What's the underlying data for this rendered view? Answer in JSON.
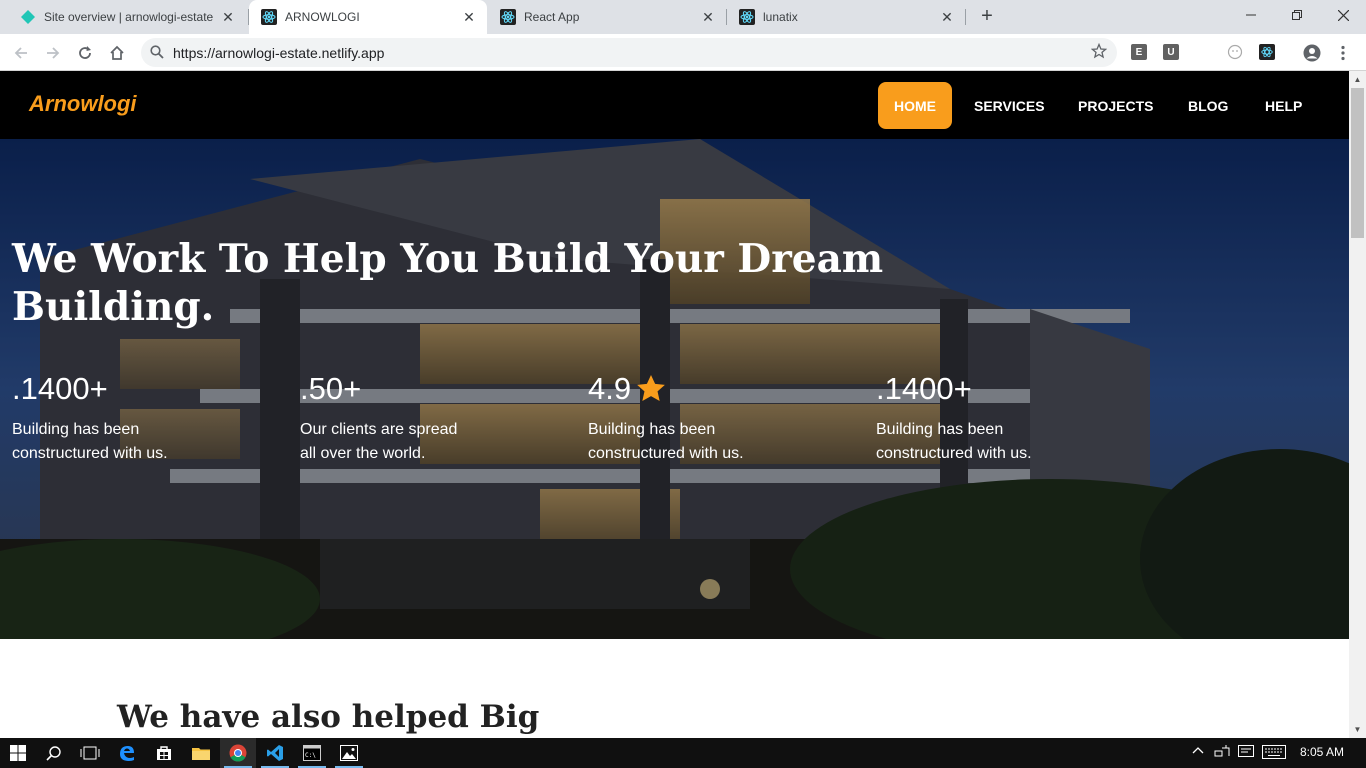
{
  "browser": {
    "tabs": [
      {
        "title": "Site overview | arnowlogi-estate",
        "icon": "netlify-diamond-icon"
      },
      {
        "title": "ARNOWLOGI",
        "icon": "react-icon"
      },
      {
        "title": "React App",
        "icon": "react-icon"
      },
      {
        "title": "lunatix",
        "icon": "react-icon"
      }
    ],
    "url": "https://arnowlogi-estate.netlify.app",
    "extensions": [
      "E",
      "U"
    ]
  },
  "site": {
    "logo": "Arnowlogi",
    "nav": [
      "HOME",
      "SERVICES",
      "PROJECTS",
      "BLOG",
      "HELP"
    ],
    "active_nav": "HOME",
    "accent_color": "#f99d1c",
    "hero": {
      "headline": "We Work To Help You Build Your Dream Building.",
      "stats": [
        {
          "value": ".1400+",
          "label": "Building has been constructured with us."
        },
        {
          "value": ".50+",
          "label": "Our clients are spread all over the world."
        },
        {
          "value": "4.9",
          "label": "Building has been constructured with us.",
          "icon": "star-icon"
        },
        {
          "value": ".1400+",
          "label": "Building has been constructured with us."
        }
      ]
    },
    "partners_heading": "We have also helped Big"
  },
  "taskbar": {
    "time": "8:05 AM"
  }
}
